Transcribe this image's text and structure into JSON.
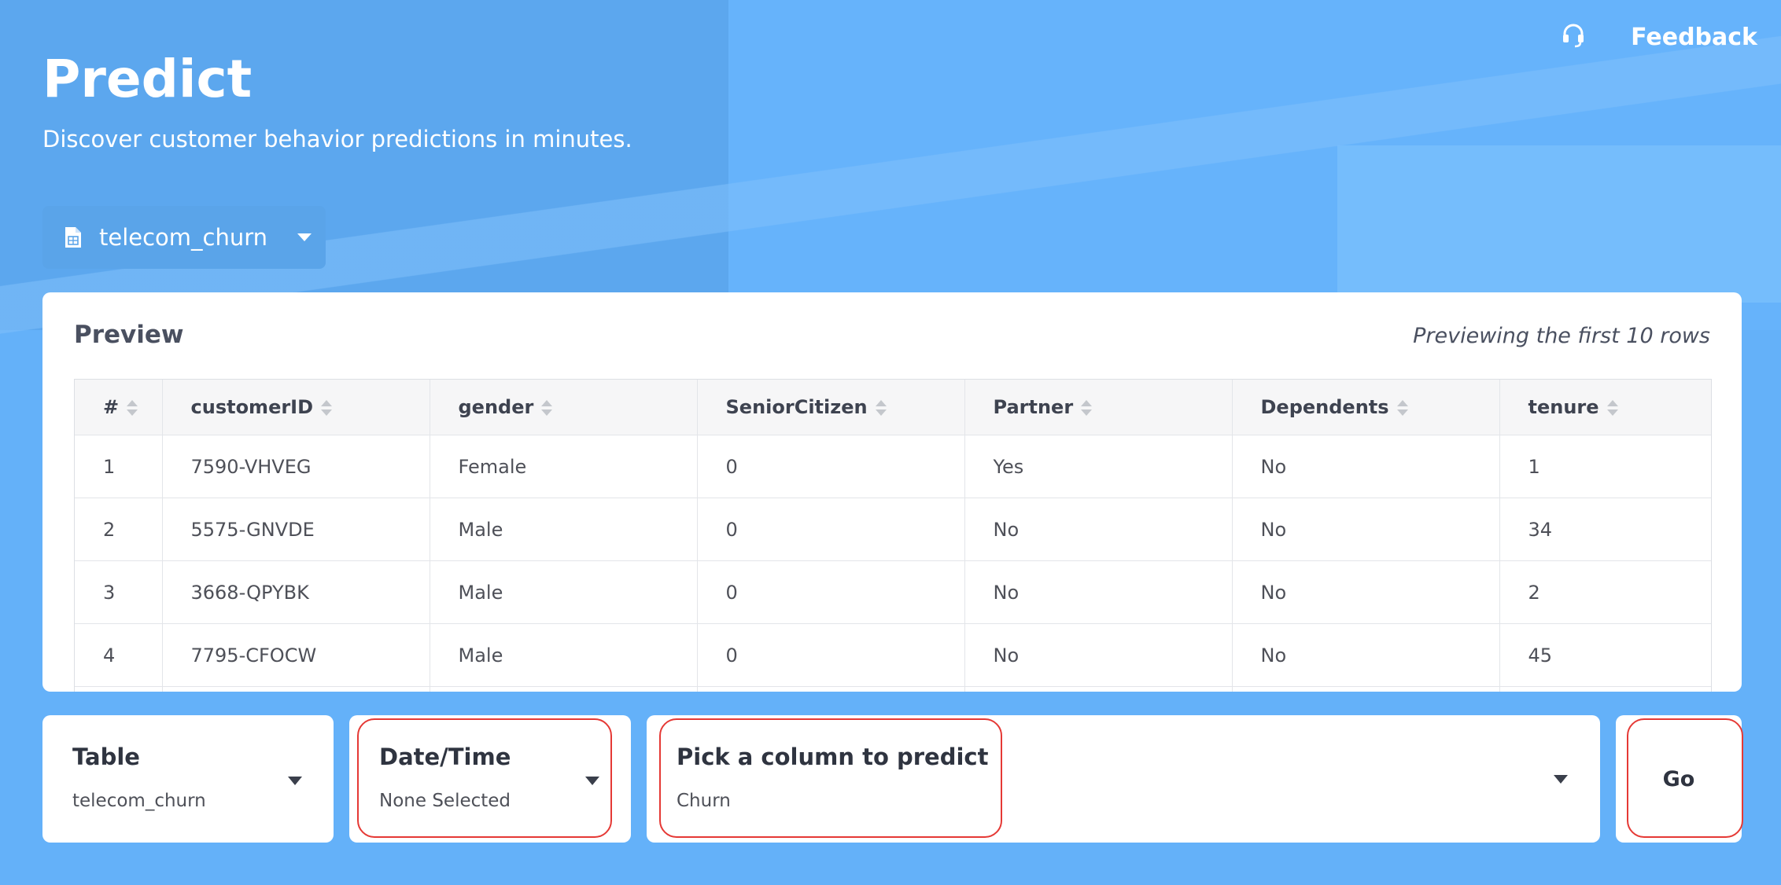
{
  "header": {
    "title": "Predict",
    "subtitle": "Discover customer behavior predictions in minutes.",
    "feedback_label": "Feedback"
  },
  "dataset_selector": {
    "selected": "telecom_churn"
  },
  "preview": {
    "title": "Preview",
    "note": "Previewing the first 10 rows",
    "columns": [
      "#",
      "customerID",
      "gender",
      "SeniorCitizen",
      "Partner",
      "Dependents",
      "tenure"
    ],
    "rows": [
      [
        "1",
        "7590-VHVEG",
        "Female",
        "0",
        "Yes",
        "No",
        "1"
      ],
      [
        "2",
        "5575-GNVDE",
        "Male",
        "0",
        "No",
        "No",
        "34"
      ],
      [
        "3",
        "3668-QPYBK",
        "Male",
        "0",
        "No",
        "No",
        "2"
      ],
      [
        "4",
        "7795-CFOCW",
        "Male",
        "0",
        "No",
        "No",
        "45"
      ],
      [
        "",
        "",
        "",
        "",
        "",
        "",
        ""
      ]
    ]
  },
  "controls": {
    "table": {
      "label": "Table",
      "value": "telecom_churn"
    },
    "datetime": {
      "label": "Date/Time",
      "value": "None Selected"
    },
    "predict_column": {
      "label": "Pick a column to predict",
      "value": "Churn"
    },
    "go_label": "Go"
  },
  "colors": {
    "background": "#64b1f9",
    "highlight": "#e53935"
  },
  "icons": [
    "headset-icon",
    "file-spreadsheet-icon",
    "caret-down-icon",
    "sort-icon"
  ]
}
